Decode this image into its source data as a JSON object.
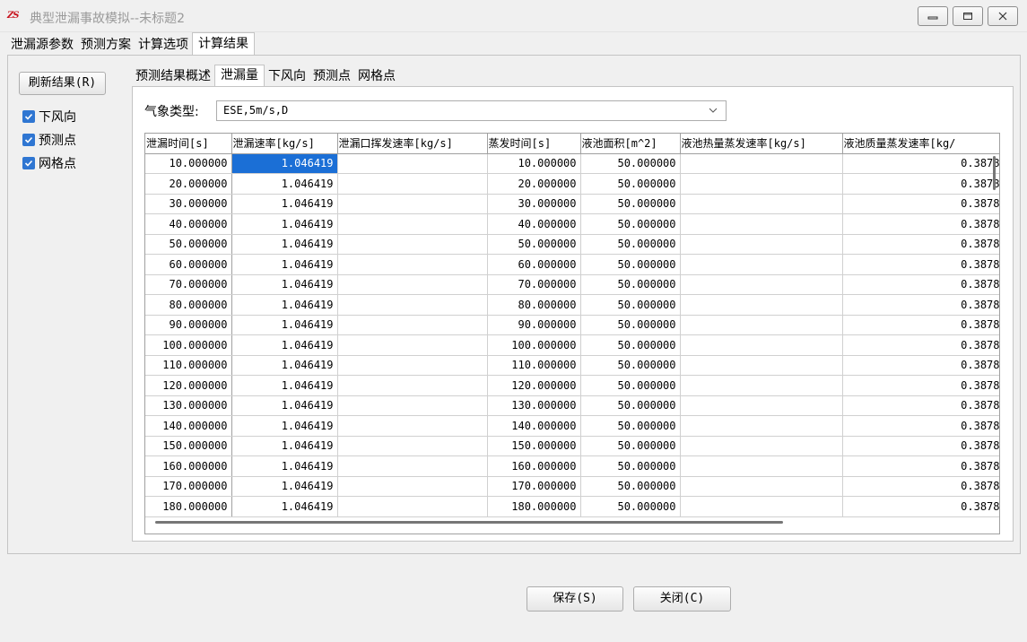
{
  "window": {
    "title": "典型泄漏事故模拟--未标题2",
    "logo_text": "ZS"
  },
  "top_tabs": [
    {
      "label": "泄漏源参数"
    },
    {
      "label": "预测方案"
    },
    {
      "label": "计算选项"
    },
    {
      "label": "计算结果"
    }
  ],
  "left_panel": {
    "refresh_label": "刷新结果(R)",
    "checkboxes": [
      {
        "label": "下风向",
        "checked": true
      },
      {
        "label": "预测点",
        "checked": true
      },
      {
        "label": "网格点",
        "checked": true
      }
    ]
  },
  "sub_tabs": [
    {
      "label": "预测结果概述"
    },
    {
      "label": "泄漏量"
    },
    {
      "label": "下风向"
    },
    {
      "label": "预测点"
    },
    {
      "label": "网格点"
    }
  ],
  "weather": {
    "label": "气象类型:",
    "value": "ESE,5m/s,D"
  },
  "table": {
    "columns": [
      "泄漏时间[s]",
      "泄漏速率[kg/s]",
      "泄漏口挥发速率[kg/s]",
      "蒸发时间[s]",
      "液池面积[m^2]",
      "液池热量蒸发速率[kg/s]",
      "液池质量蒸发速率[kg/"
    ],
    "rows": [
      [
        "10.000000",
        "1.046419",
        "",
        "10.000000",
        "50.000000",
        "",
        "0.3878"
      ],
      [
        "20.000000",
        "1.046419",
        "",
        "20.000000",
        "50.000000",
        "",
        "0.3878"
      ],
      [
        "30.000000",
        "1.046419",
        "",
        "30.000000",
        "50.000000",
        "",
        "0.3878"
      ],
      [
        "40.000000",
        "1.046419",
        "",
        "40.000000",
        "50.000000",
        "",
        "0.3878"
      ],
      [
        "50.000000",
        "1.046419",
        "",
        "50.000000",
        "50.000000",
        "",
        "0.3878"
      ],
      [
        "60.000000",
        "1.046419",
        "",
        "60.000000",
        "50.000000",
        "",
        "0.3878"
      ],
      [
        "70.000000",
        "1.046419",
        "",
        "70.000000",
        "50.000000",
        "",
        "0.3878"
      ],
      [
        "80.000000",
        "1.046419",
        "",
        "80.000000",
        "50.000000",
        "",
        "0.3878"
      ],
      [
        "90.000000",
        "1.046419",
        "",
        "90.000000",
        "50.000000",
        "",
        "0.3878"
      ],
      [
        "100.000000",
        "1.046419",
        "",
        "100.000000",
        "50.000000",
        "",
        "0.3878"
      ],
      [
        "110.000000",
        "1.046419",
        "",
        "110.000000",
        "50.000000",
        "",
        "0.3878"
      ],
      [
        "120.000000",
        "1.046419",
        "",
        "120.000000",
        "50.000000",
        "",
        "0.3878"
      ],
      [
        "130.000000",
        "1.046419",
        "",
        "130.000000",
        "50.000000",
        "",
        "0.3878"
      ],
      [
        "140.000000",
        "1.046419",
        "",
        "140.000000",
        "50.000000",
        "",
        "0.3878"
      ],
      [
        "150.000000",
        "1.046419",
        "",
        "150.000000",
        "50.000000",
        "",
        "0.3878"
      ],
      [
        "160.000000",
        "1.046419",
        "",
        "160.000000",
        "50.000000",
        "",
        "0.3878"
      ],
      [
        "170.000000",
        "1.046419",
        "",
        "170.000000",
        "50.000000",
        "",
        "0.3878"
      ],
      [
        "180.000000",
        "1.046419",
        "",
        "180.000000",
        "50.000000",
        "",
        "0.3878"
      ]
    ],
    "selected_cell": {
      "row": 0,
      "col": 1
    }
  },
  "footer": {
    "save_label": "保存(S)",
    "close_label": "关闭(C)"
  },
  "colors": {
    "accent": "#1b6fd6",
    "checkbox": "#2f76d2",
    "logo": "#c8141e"
  }
}
